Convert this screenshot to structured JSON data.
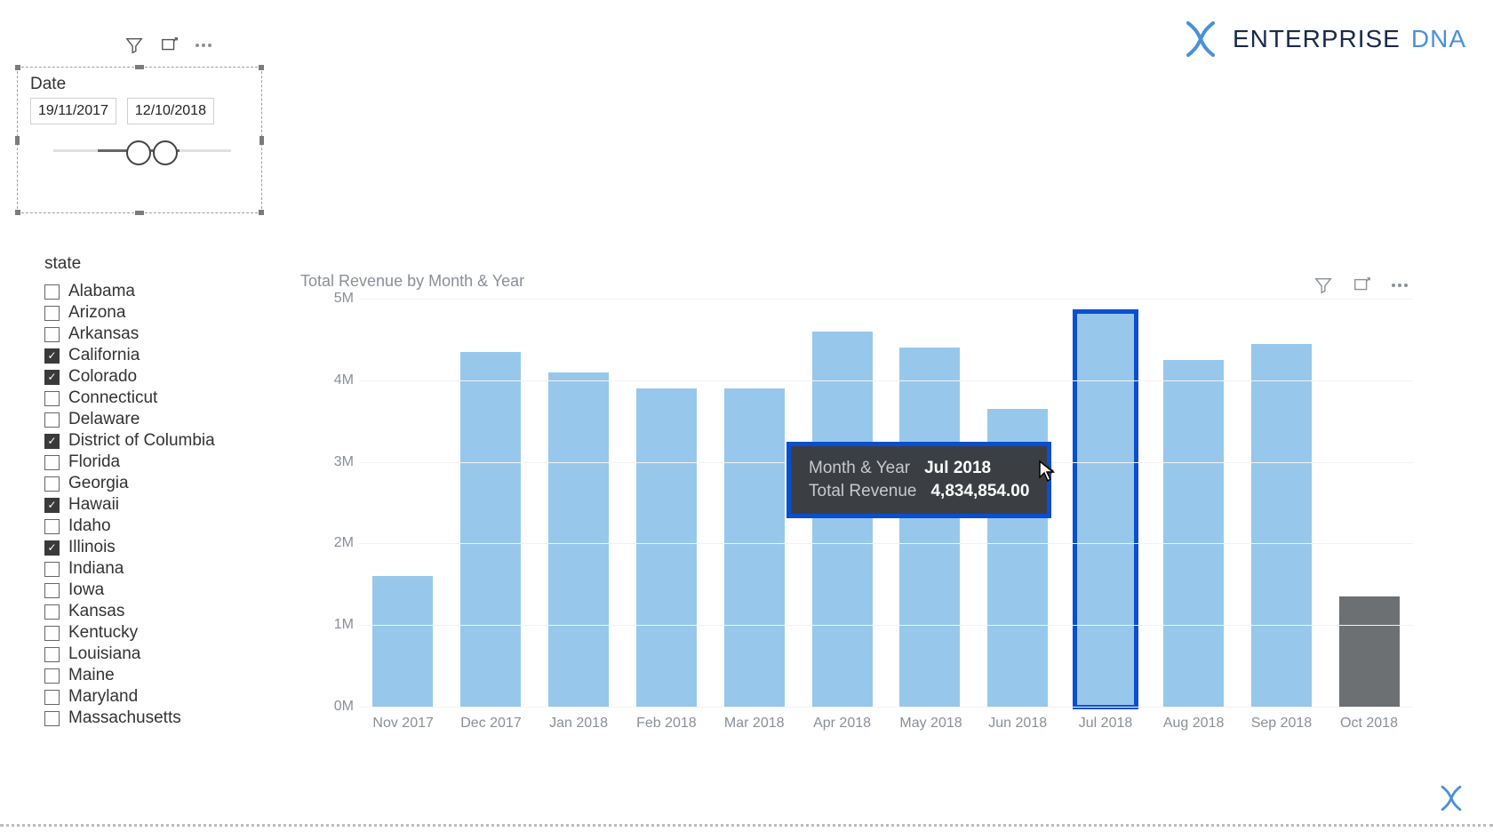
{
  "brand": {
    "name": "ENTERPRISE",
    "suffix": "DNA"
  },
  "date_slicer": {
    "title": "Date",
    "from": "19/11/2017",
    "to": "12/10/2018"
  },
  "state_slicer": {
    "title": "state",
    "items": [
      {
        "label": "Alabama",
        "checked": false
      },
      {
        "label": "Arizona",
        "checked": false
      },
      {
        "label": "Arkansas",
        "checked": false
      },
      {
        "label": "California",
        "checked": true
      },
      {
        "label": "Colorado",
        "checked": true
      },
      {
        "label": "Connecticut",
        "checked": false
      },
      {
        "label": "Delaware",
        "checked": false
      },
      {
        "label": "District of Columbia",
        "checked": true
      },
      {
        "label": "Florida",
        "checked": false
      },
      {
        "label": "Georgia",
        "checked": false
      },
      {
        "label": "Hawaii",
        "checked": true
      },
      {
        "label": "Idaho",
        "checked": false
      },
      {
        "label": "Illinois",
        "checked": true
      },
      {
        "label": "Indiana",
        "checked": false
      },
      {
        "label": "Iowa",
        "checked": false
      },
      {
        "label": "Kansas",
        "checked": false
      },
      {
        "label": "Kentucky",
        "checked": false
      },
      {
        "label": "Louisiana",
        "checked": false
      },
      {
        "label": "Maine",
        "checked": false
      },
      {
        "label": "Maryland",
        "checked": false
      },
      {
        "label": "Massachusetts",
        "checked": false
      }
    ]
  },
  "chart_title": "Total Revenue by Month & Year",
  "tooltip": {
    "label1": "Month & Year",
    "value1": "Jul 2018",
    "label2": "Total Revenue",
    "value2": "4,834,854.00"
  },
  "chart_data": {
    "type": "bar",
    "title": "Total Revenue by Month & Year",
    "xlabel": "",
    "ylabel": "",
    "ylim": [
      0,
      5000000
    ],
    "y_ticks_labels": [
      "0M",
      "1M",
      "2M",
      "3M",
      "4M",
      "5M"
    ],
    "categories": [
      "Nov 2017",
      "Dec 2017",
      "Jan 2018",
      "Feb 2018",
      "Mar 2018",
      "Apr 2018",
      "May 2018",
      "Jun 2018",
      "Jul 2018",
      "Aug 2018",
      "Sep 2018",
      "Oct 2018"
    ],
    "values": [
      1600000,
      4350000,
      4100000,
      3900000,
      3900000,
      4600000,
      4400000,
      3650000,
      4834854,
      4250000,
      4450000,
      1350000
    ],
    "highlight_index": 8,
    "series_colors": {
      "default": "#97c8ec",
      "last": "#6c7072"
    }
  }
}
